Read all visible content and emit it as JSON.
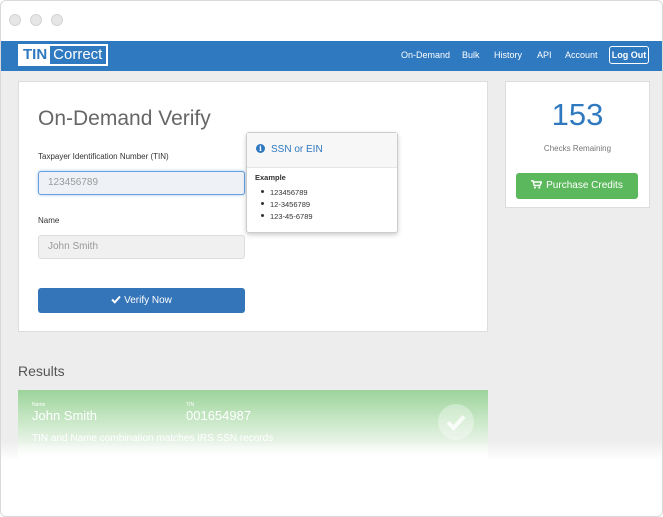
{
  "nav": {
    "logo_bold": "TIN",
    "logo_rest": "Correct",
    "links": [
      "On-Demand",
      "Bulk",
      "History",
      "API",
      "Account"
    ],
    "logout": "Log Out"
  },
  "verify_form": {
    "title": "On-Demand Verify",
    "tin_label": "Taxpayer Identification Number (TIN)",
    "tin_placeholder": "123456789",
    "name_label": "Name",
    "name_placeholder": "John Smith",
    "submit": "Verify Now",
    "submit_icon": "check-icon"
  },
  "popover": {
    "icon": "info-icon",
    "title": "SSN or EIN",
    "example_label": "Example",
    "examples": [
      "123456789",
      "12-3456789",
      "123-45-6789"
    ]
  },
  "credits": {
    "count": "153",
    "label": "Checks Remaining",
    "button": "Purchase Credits",
    "button_icon": "cart-icon"
  },
  "results": {
    "heading": "Results",
    "items": [
      {
        "name_caption": "Name",
        "name": "John Smith",
        "tin_caption": "TIN",
        "tin": "001654987",
        "message": "TIN and Name combination matches IRS SSN records",
        "status_icon": "check-circle-icon"
      }
    ]
  },
  "colors": {
    "brand": "#2f79c0",
    "success": "#5cb85c",
    "result_bg": "#9dd39b"
  }
}
